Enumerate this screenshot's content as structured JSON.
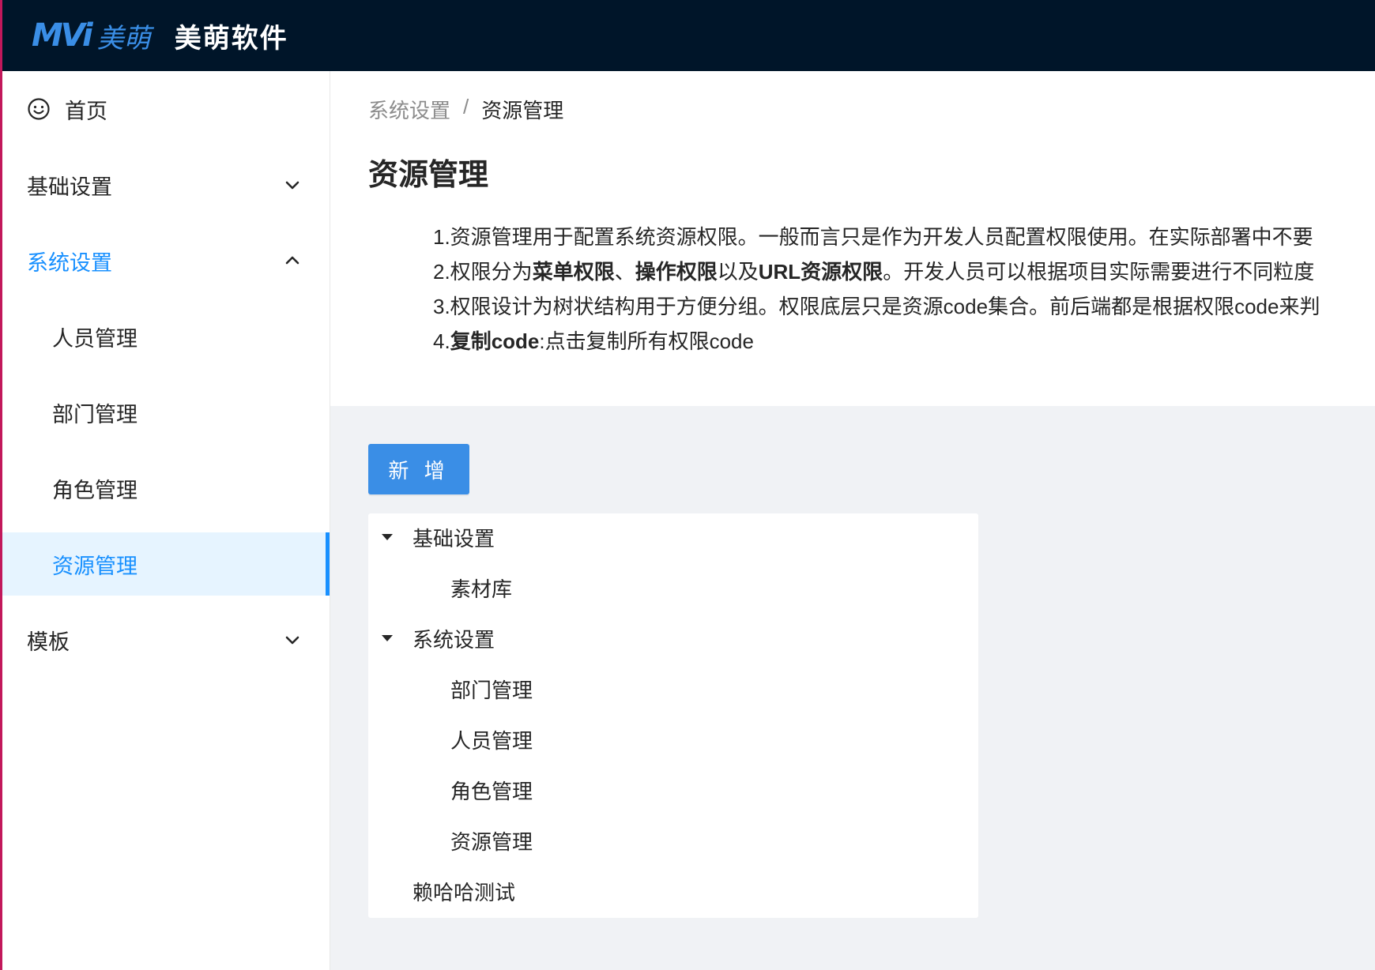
{
  "header": {
    "logo_mark": "MVi",
    "logo_cn": "美萌",
    "app_title": "美萌软件"
  },
  "sidebar": {
    "items": [
      {
        "label": "首页",
        "icon": "smile-icon"
      },
      {
        "label": "基础设置",
        "expanded": false
      },
      {
        "label": "系统设置",
        "expanded": true,
        "children": [
          "人员管理",
          "部门管理",
          "角色管理",
          "资源管理"
        ]
      },
      {
        "label": "模板",
        "expanded": false
      }
    ],
    "selected": "资源管理",
    "accent_color": "#1890ff"
  },
  "breadcrumb": [
    "系统设置",
    "资源管理"
  ],
  "breadcrumb_separator": "/",
  "page_title": "资源管理",
  "description": {
    "line1": "1.资源管理用于配置系统资源权限。一般而言只是作为开发人员配置权限使用。在实际部署中不要",
    "line2_prefix": "2.权限分为",
    "line2_b1": "菜单权限",
    "line2_sep1": "、",
    "line2_b2": "操作权限",
    "line2_mid": "以及",
    "line2_b3": "URL资源权限",
    "line2_suffix": "。开发人员可以根据项目实际需要进行不同粒度",
    "line3": "3.权限设计为树状结构用于方便分组。权限底层只是资源code集合。前后端都是根据权限code来判",
    "line4_prefix": "4.",
    "line4_b": "复制code",
    "line4_suffix": ":点击复制所有权限code"
  },
  "add_button": "新 增",
  "tree": [
    {
      "label": "基础设置",
      "expanded": true,
      "children": [
        "素材库"
      ]
    },
    {
      "label": "系统设置",
      "expanded": true,
      "children": [
        "部门管理",
        "人员管理",
        "角色管理",
        "资源管理"
      ]
    },
    {
      "label": "赖哈哈测试",
      "expanded": false
    }
  ],
  "colors": {
    "header_bg": "#001529",
    "primary": "#3a8ee6",
    "page_bg": "#f0f2f5"
  }
}
